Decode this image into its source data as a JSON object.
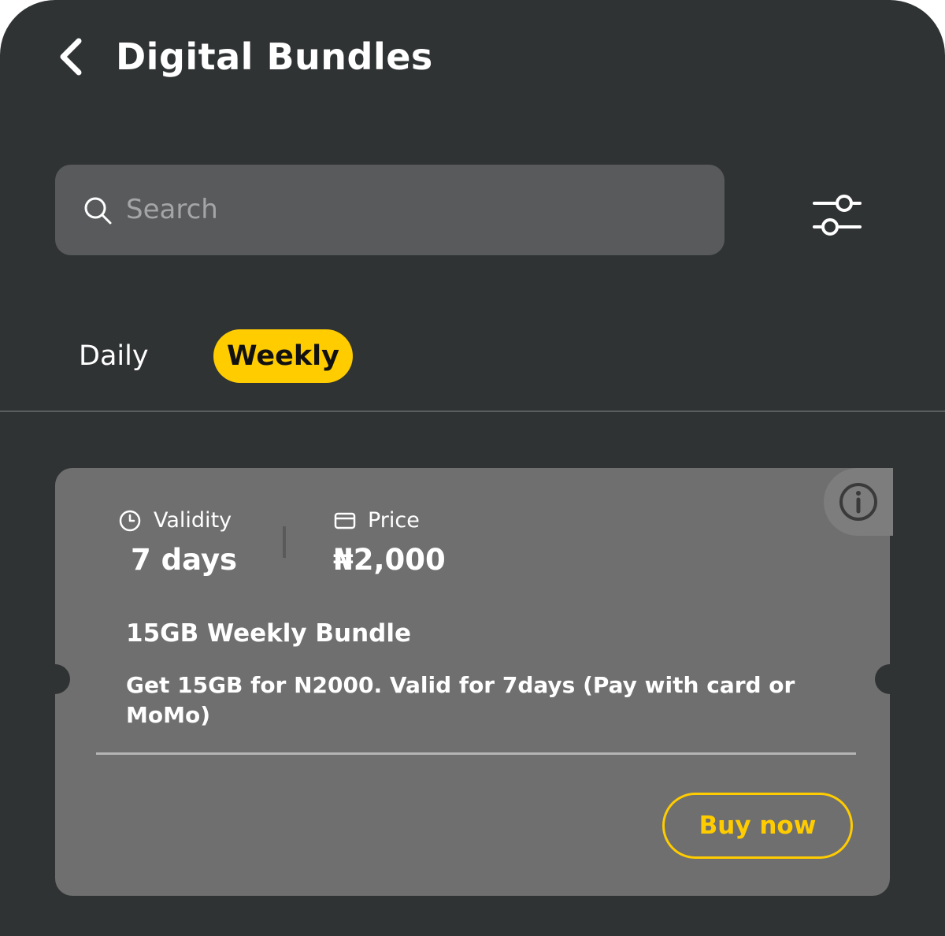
{
  "header": {
    "title": "Digital Bundles"
  },
  "search": {
    "placeholder": "Search",
    "value": ""
  },
  "tabs": [
    {
      "label": "Daily",
      "selected": false
    },
    {
      "label": "Weekly",
      "selected": true
    }
  ],
  "bundle": {
    "validity_label": "Validity",
    "validity_value": "7 days",
    "price_label": "Price",
    "price_value": "₦2,000",
    "name": "15GB Weekly Bundle",
    "description": "Get 15GB for N2000. Valid for 7days (Pay with card or MoMo)",
    "buy_label": "Buy now"
  },
  "icons": {
    "back": "chevron-left-icon",
    "search": "search-icon",
    "filter": "sliders-icon",
    "info": "info-icon",
    "validity": "clock-icon",
    "price": "card-icon"
  },
  "colors": {
    "background": "#303334",
    "search_field": "#585a5b",
    "card": "#6f6f6f",
    "accent": "#ffcc00",
    "text": "#ffffff"
  }
}
